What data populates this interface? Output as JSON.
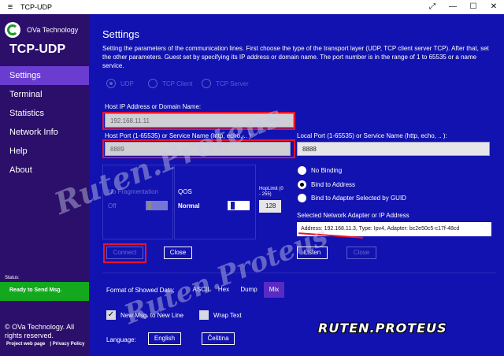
{
  "window": {
    "title": "TCP-UDP",
    "hamburger": "≡",
    "minimize": "—",
    "restore": "⤢",
    "maximize": "☐",
    "close": "✕"
  },
  "sidebar": {
    "company": "OVa Technology",
    "app_name": "TCP-UDP",
    "items": [
      {
        "label": "Settings",
        "active": true
      },
      {
        "label": "Terminal"
      },
      {
        "label": "Statistics"
      },
      {
        "label": "Network Info"
      },
      {
        "label": "Help"
      },
      {
        "label": "About"
      }
    ],
    "status_label": "Status:",
    "status_text": "Ready to Send Msg.",
    "copyright": "© OVa Technology. All rights reserved.",
    "link_project": "Project web page",
    "link_privacy": "Privacy Policy"
  },
  "settings": {
    "title": "Settings",
    "description": "Setting the parameters of the communication lines. First choose the type of the transport layer (UDP, TCP client server TCP). After that, set the other parameters. Guest set by specifying its IP address or domain name. The port number is in the range of 1 to 65535 or a name service.",
    "protocols": [
      "UDP",
      "TCP Client",
      "TCP Server"
    ],
    "host_ip_label": "Host IP Address or Domain Name:",
    "host_ip_value": "192.168.11.11",
    "host_port_label": "Host Port (1-65535) or Service Name (http, echo, .. ):",
    "host_port_value": "8889",
    "local_port_label": "Local Port (1-65535) or Service Name (http, echo, .. ):",
    "local_port_value": "8888",
    "no_frag_label": "No Fragmentation",
    "no_frag_value": "Off",
    "qos_label": "QOS",
    "qos_value": "Normal",
    "hop_label": "HopLimit (0 - 255)",
    "hop_value": "128",
    "binding_options": [
      "No Binding",
      "Bind to Address",
      "Bind to Adapter Selected by GUID"
    ],
    "selected_binding_index": 1,
    "adapter_label": "Selected Network Adapter or IP Address",
    "adapter_value": "Address: 192.168.11.3,   Type: Ipv4,   Adapter: bc2e50c5-c17f-48cd",
    "connect_label": "Connect",
    "close_label": "Close",
    "listen_label": "Listen",
    "close2_label": "Close"
  },
  "format": {
    "label": "Format of Showed Data:",
    "options": [
      "ASCII",
      "Hex",
      "Dump",
      "Mix"
    ],
    "selected": "Mix",
    "new_msg_label": "New Msg. to New Line",
    "new_msg_checked": true,
    "wrap_label": "Wrap Text",
    "wrap_checked": false,
    "language_label": "Language:",
    "english_label": "English",
    "czech_label": "Čeština"
  },
  "watermark": {
    "text_1": "Ruten.Proteus",
    "text_2": "Ruten.Proteus",
    "stamp": "RUTEN.PROTEUS"
  },
  "colors": {
    "sidebar": "#2b0f6b",
    "main": "#1212b0",
    "active_nav": "#6a3ccf",
    "status": "#14a81e",
    "highlight": "#e8132a"
  }
}
